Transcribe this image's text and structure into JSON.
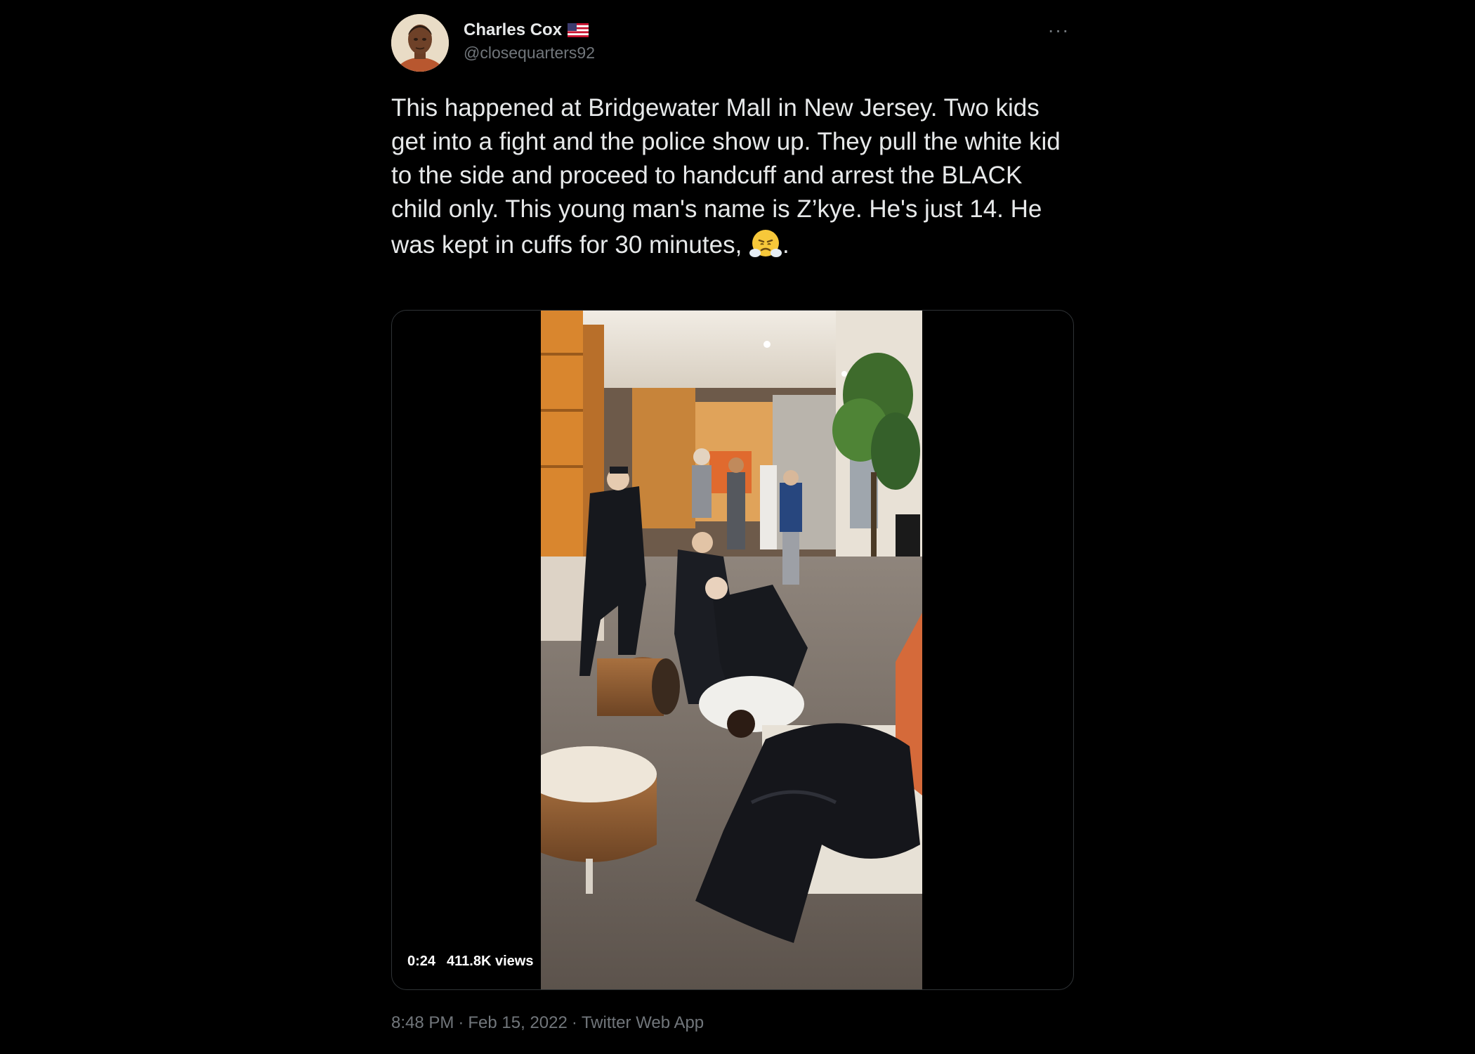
{
  "user": {
    "display_name": "Charles Cox",
    "handle": "@closequarters92",
    "flag_icon": "us-flag-icon",
    "avatar_icon": "avatar"
  },
  "more_label": "···",
  "tweet": {
    "text": "This happened at Bridgewater Mall in New Jersey. Two kids get into a fight and the police show up. They pull the white kid to the side and proceed to handcuff and arrest the BLACK child only. This young man's name is Z’kye. He's just 14. He was kept in cuffs for 30 minutes, ",
    "emoji_icon": "steam-from-nose-emoji-icon",
    "text_end": "."
  },
  "media": {
    "duration": "0:24",
    "views": "411.8K views"
  },
  "footer": {
    "time": "8:48 PM",
    "sep1": "·",
    "date": "Feb 15, 2022",
    "sep2": "·",
    "app": "Twitter Web App"
  },
  "colors": {
    "background": "#000000",
    "text_primary": "#e7e9ea",
    "text_secondary": "#71767b",
    "border": "#2f3336"
  }
}
